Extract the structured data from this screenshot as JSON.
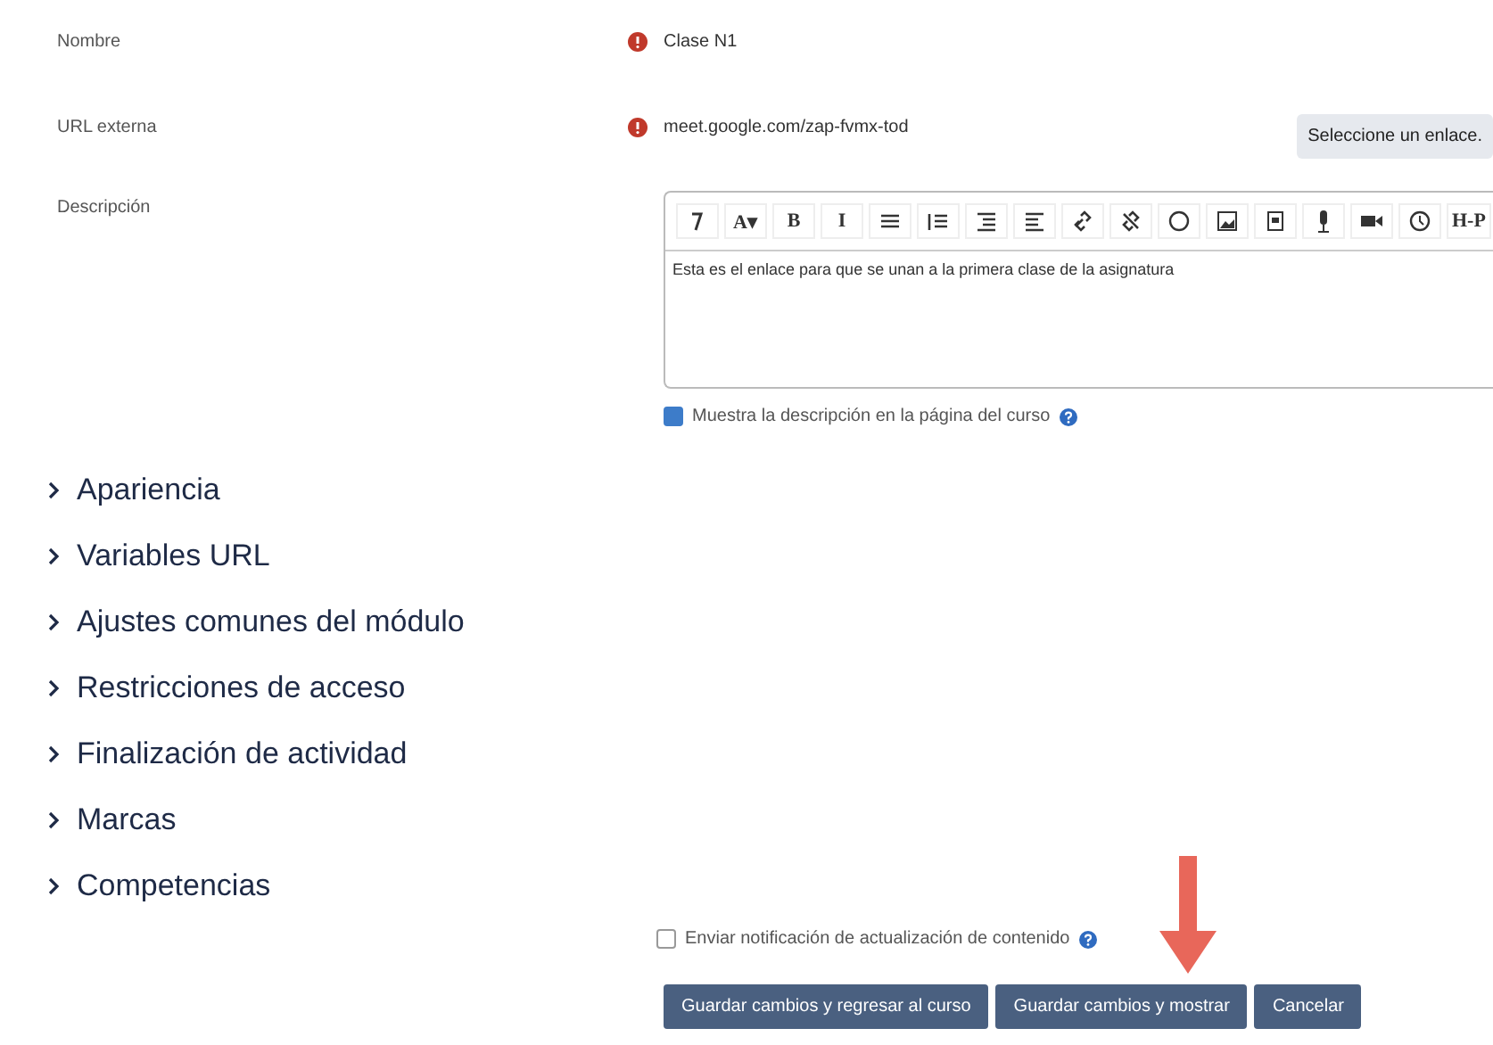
{
  "fields": [
    {
      "label": "Nombre",
      "required": true,
      "value": "Clase N1"
    },
    {
      "label": "URL externa",
      "required": true,
      "value": "meet.google.com/zap-fvmx-tod",
      "button": "Seleccione un enlace."
    }
  ],
  "description": {
    "label": "Descripción",
    "toolbar": [
      {
        "kind": "icon"
      },
      {
        "kind": "text",
        "label": "A▾"
      },
      {
        "kind": "text",
        "label": "B"
      },
      {
        "kind": "text",
        "label": "I"
      },
      {
        "kind": "icon"
      },
      {
        "kind": "icon"
      },
      {
        "kind": "icon"
      },
      {
        "kind": "icon"
      },
      {
        "kind": "icon"
      },
      {
        "kind": "icon"
      },
      {
        "kind": "icon"
      },
      {
        "kind": "icon"
      },
      {
        "kind": "icon"
      },
      {
        "kind": "icon"
      },
      {
        "kind": "icon"
      },
      {
        "kind": "icon"
      },
      {
        "kind": "text",
        "label": "H-P"
      }
    ],
    "text": "Esta es el enlace para que se unan a la primera clase de la asignatura"
  },
  "show_description": {
    "label": "Muestra la descripción en la página del curso",
    "checked": true
  },
  "sections": [
    {
      "label": "Apariencia",
      "expanded": false
    },
    {
      "label": "Variables URL",
      "expanded": false
    },
    {
      "label": "Ajustes comunes del módulo",
      "expanded": false
    },
    {
      "label": "Restricciones de acceso",
      "expanded": false
    },
    {
      "label": "Finalización de actividad",
      "expanded": false
    },
    {
      "label": "Marcas",
      "expanded": false
    },
    {
      "label": "Competencias",
      "expanded": false
    }
  ],
  "notify": {
    "label": "Enviar notificación de actualización de contenido",
    "checked": false
  },
  "buttons": [
    "Guardar cambios y regresar al curso",
    "Guardar cambios y mostrar",
    "Cancelar"
  ]
}
